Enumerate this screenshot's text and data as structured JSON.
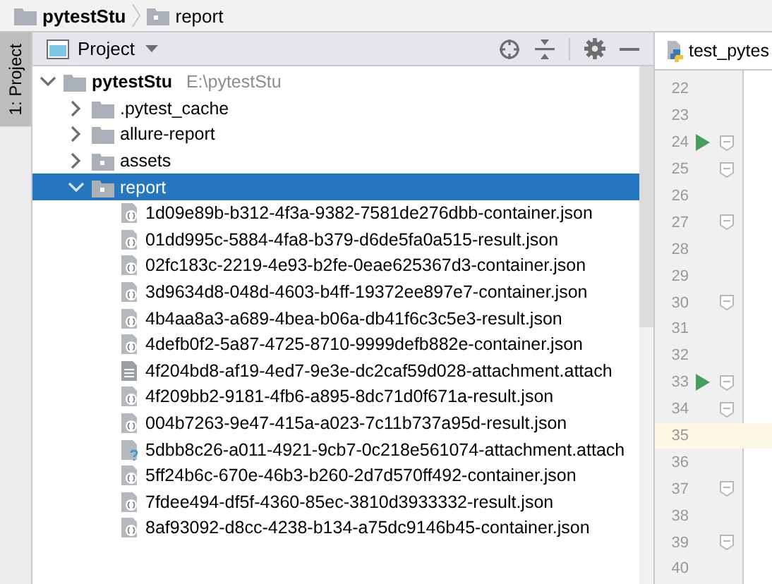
{
  "breadcrumb": [
    {
      "label": "pytestStu",
      "bold": true
    },
    {
      "label": "report",
      "bold": false
    }
  ],
  "tool_strip": {
    "label": "1: Project"
  },
  "project_panel": {
    "title": "Project",
    "tree": [
      {
        "label": "pytestStu",
        "path": "E:\\pytestStu",
        "kind": "folder",
        "expanded": true,
        "selected": false,
        "children": [
          {
            "label": ".pytest_cache",
            "kind": "folder",
            "expanded": false,
            "selected": false
          },
          {
            "label": "allure-report",
            "kind": "folder",
            "expanded": false,
            "selected": false
          },
          {
            "label": "assets",
            "kind": "package",
            "expanded": false,
            "selected": false
          },
          {
            "label": "report",
            "kind": "package",
            "expanded": true,
            "selected": true,
            "children": [
              {
                "label": "1d09e89b-b312-4f3a-9382-7581de276dbb-container.json",
                "kind": "json",
                "selected": false
              },
              {
                "label": "01dd995c-5884-4fa8-b379-d6de5fa0a515-result.json",
                "kind": "json",
                "selected": false
              },
              {
                "label": "02fc183c-2219-4e93-b2fe-0eae625367d3-container.json",
                "kind": "json",
                "selected": false
              },
              {
                "label": "3d9634d8-048d-4603-b4ff-19372ee897e7-container.json",
                "kind": "json",
                "selected": false
              },
              {
                "label": "4b4aa8a3-a689-4bea-b06a-db41f6c3c5e3-result.json",
                "kind": "json",
                "selected": false
              },
              {
                "label": "4defb0f2-5a87-4725-8710-9999defb882e-container.json",
                "kind": "json",
                "selected": false
              },
              {
                "label": "4f204bd8-af19-4ed7-9e3e-dc2caf59d028-attachment.attach",
                "kind": "text",
                "selected": false
              },
              {
                "label": "4f209bb2-9181-4fb6-a895-8dc71d0f671a-result.json",
                "kind": "json",
                "selected": false
              },
              {
                "label": "004b7263-9e47-415a-a023-7c11b737a95d-result.json",
                "kind": "json",
                "selected": false
              },
              {
                "label": "5dbb8c26-a011-4921-9cb7-0c218e561074-attachment.attach",
                "kind": "unknown",
                "selected": false
              },
              {
                "label": "5ff24b6c-670e-46b3-b260-2d7d570ff492-container.json",
                "kind": "json",
                "selected": false
              },
              {
                "label": "7fdee494-df5f-4360-85ec-3810d3933332-result.json",
                "kind": "json",
                "selected": false
              },
              {
                "label": "8af93092-d8cc-4238-b134-a75dc9146b45-container.json",
                "kind": "json",
                "selected": false
              }
            ]
          }
        ]
      }
    ]
  },
  "editor": {
    "tab": {
      "label": "test_pytes",
      "selected": true
    },
    "lines": [
      {
        "number": "22",
        "run": false,
        "fold": false,
        "current": false
      },
      {
        "number": "23",
        "run": false,
        "fold": false,
        "current": false
      },
      {
        "number": "24",
        "run": true,
        "fold": true,
        "current": false
      },
      {
        "number": "25",
        "run": false,
        "fold": true,
        "current": false
      },
      {
        "number": "26",
        "run": false,
        "fold": false,
        "current": false
      },
      {
        "number": "27",
        "run": false,
        "fold": true,
        "current": false
      },
      {
        "number": "28",
        "run": false,
        "fold": false,
        "current": false
      },
      {
        "number": "29",
        "run": false,
        "fold": false,
        "current": false
      },
      {
        "number": "30",
        "run": false,
        "fold": true,
        "current": false
      },
      {
        "number": "31",
        "run": false,
        "fold": false,
        "current": false
      },
      {
        "number": "32",
        "run": false,
        "fold": false,
        "current": false
      },
      {
        "number": "33",
        "run": true,
        "fold": true,
        "current": false
      },
      {
        "number": "34",
        "run": false,
        "fold": true,
        "current": false
      },
      {
        "number": "35",
        "run": false,
        "fold": false,
        "current": true
      },
      {
        "number": "36",
        "run": false,
        "fold": false,
        "current": false
      },
      {
        "number": "37",
        "run": false,
        "fold": true,
        "current": false
      },
      {
        "number": "38",
        "run": false,
        "fold": false,
        "current": false
      },
      {
        "number": "39",
        "run": false,
        "fold": true,
        "current": false
      },
      {
        "number": "40",
        "run": false,
        "fold": false,
        "current": false
      }
    ]
  }
}
